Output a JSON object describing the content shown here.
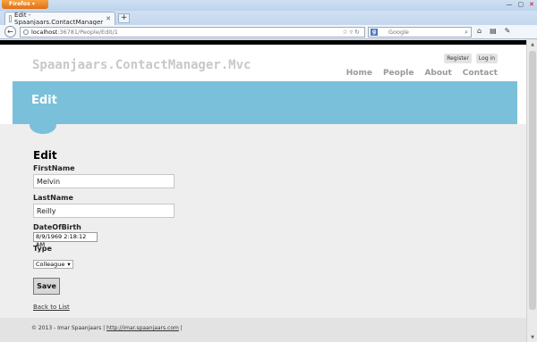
{
  "browser": {
    "menu_button": "Firefox",
    "tab_title": "Edit - Spaanjaars.ContactManager",
    "new_tab": "+",
    "url_host": "localhost",
    "url_path": ":36781/People/Edit/1",
    "search_placeholder": "Google",
    "search_engine_letter": "g"
  },
  "site": {
    "title": "Spaanjaars.ContactManager.Mvc",
    "register": "Register",
    "login": "Log in",
    "nav": [
      "Home",
      "People",
      "About",
      "Contact"
    ],
    "banner_title": "Edit"
  },
  "form": {
    "heading": "Edit",
    "first_name_label": "FirstName",
    "first_name_value": "Melvin",
    "last_name_label": "LastName",
    "last_name_value": "Reilly",
    "dob_label": "DateOfBirth",
    "dob_value": "8/9/1969 2:18:12 AM",
    "type_label": "Type",
    "type_value": "Colleague",
    "save_label": "Save",
    "back_label": "Back to List"
  },
  "footer": {
    "prefix": "© 2013 - Imar Spaanjaars | ",
    "link": "http://imar.spaanjaars.com",
    "suffix": " |"
  }
}
